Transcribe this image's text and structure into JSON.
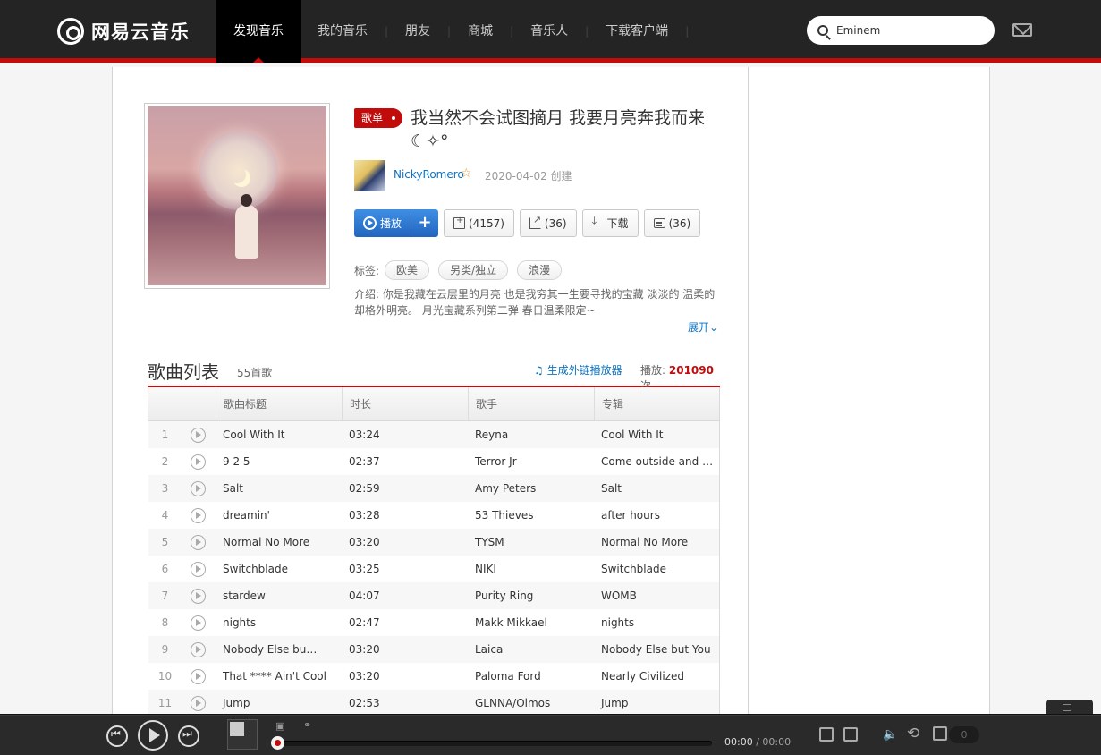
{
  "header": {
    "logo_text": "网易云音乐",
    "nav": [
      "发现音乐",
      "我的音乐",
      "朋友",
      "商城",
      "音乐人",
      "下载客户端"
    ],
    "search_value": "Eminem"
  },
  "playlist": {
    "badge": "歌单",
    "title": "我当然不会试图摘月 我要月亮奔我而来☾✧°",
    "creator": "NickyRomero",
    "created": "2020-04-02 创建",
    "play_label": "播放",
    "plus_label": "+",
    "fav_label": "(4157)",
    "share_label": "(36)",
    "download_label": "下载",
    "comment_label": "(36)",
    "tags_label": "标签:",
    "tags": [
      "欧美",
      "另类/独立",
      "浪漫"
    ],
    "intro_line1": "介绍:  你是我藏在云层里的月亮 也是我穷其一生要寻找的宝藏 淡淡的 温柔的",
    "intro_line2": "却格外明亮。 月光宝藏系列第二弹 春日温柔限定~",
    "expand_label": "展开"
  },
  "song_list": {
    "title": "歌曲列表",
    "count": "55首歌",
    "ext_link": "生成外链播放器",
    "play_count_prefix": "播放:",
    "play_count": "201090",
    "play_count_suffix": "次",
    "columns": [
      "歌曲标题",
      "时长",
      "歌手",
      "专辑"
    ],
    "rows": [
      {
        "idx": "1",
        "title": "Cool With It",
        "dur": "03:24",
        "artist": "Reyna",
        "album": "Cool With It"
      },
      {
        "idx": "2",
        "title": "9 2 5",
        "dur": "02:37",
        "artist": "Terror Jr",
        "album": "Come outside and b…"
      },
      {
        "idx": "3",
        "title": "Salt",
        "dur": "02:59",
        "artist": "Amy Peters",
        "album": "Salt"
      },
      {
        "idx": "4",
        "title": "dreamin'",
        "dur": "03:28",
        "artist": "53 Thieves",
        "album": "after hours"
      },
      {
        "idx": "5",
        "title": "Normal No More",
        "dur": "03:20",
        "artist": "TYSM",
        "album": "Normal No More"
      },
      {
        "idx": "6",
        "title": "Switchblade",
        "dur": "03:25",
        "artist": "NIKI",
        "album": "Switchblade"
      },
      {
        "idx": "7",
        "title": "stardew",
        "dur": "04:07",
        "artist": "Purity Ring",
        "album": "WOMB"
      },
      {
        "idx": "8",
        "title": "nights",
        "dur": "02:47",
        "artist": "Makk Mikkael",
        "album": "nights"
      },
      {
        "idx": "9",
        "title": "Nobody Else bu…",
        "dur": "03:20",
        "artist": "Laica",
        "album": "Nobody Else but You"
      },
      {
        "idx": "10",
        "title": "That **** Ain't Cool",
        "dur": "03:20",
        "artist": "Paloma Ford",
        "album": "Nearly Civilized"
      },
      {
        "idx": "11",
        "title": "Jump",
        "dur": "02:53",
        "artist": "GLNNA/Olmos",
        "album": "Jump"
      }
    ]
  },
  "player": {
    "time_current": "00:00",
    "time_total": "/ 00:00",
    "playlist_count": "0"
  }
}
